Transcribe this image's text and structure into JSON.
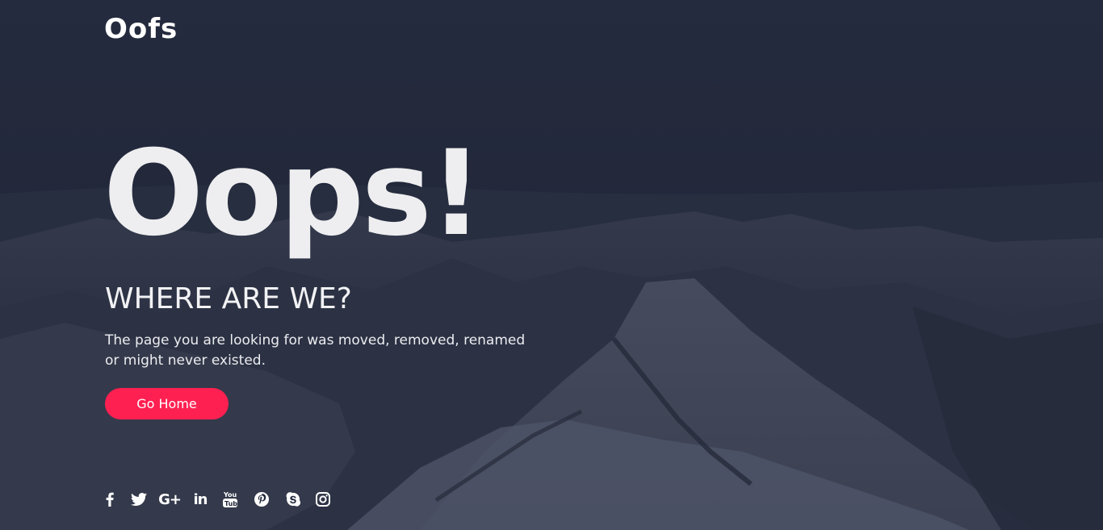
{
  "brand": {
    "logo_text": "Oofs"
  },
  "hero": {
    "headline": "Oops!",
    "subtitle": "WHERE ARE WE?",
    "message": "The page you are looking for was moved, removed, renamed or might never existed.",
    "button_label": "Go Home"
  },
  "socials": [
    {
      "icon": "facebook-icon"
    },
    {
      "icon": "twitter-icon"
    },
    {
      "icon": "google-plus-icon"
    },
    {
      "icon": "linkedin-icon"
    },
    {
      "icon": "youtube-icon"
    },
    {
      "icon": "pinterest-icon"
    },
    {
      "icon": "skype-icon"
    },
    {
      "icon": "instagram-icon"
    }
  ],
  "colors": {
    "overlay": "#22283b",
    "headline": "#eeeef0",
    "accent": "#ff2052",
    "text": "#ffffff"
  }
}
